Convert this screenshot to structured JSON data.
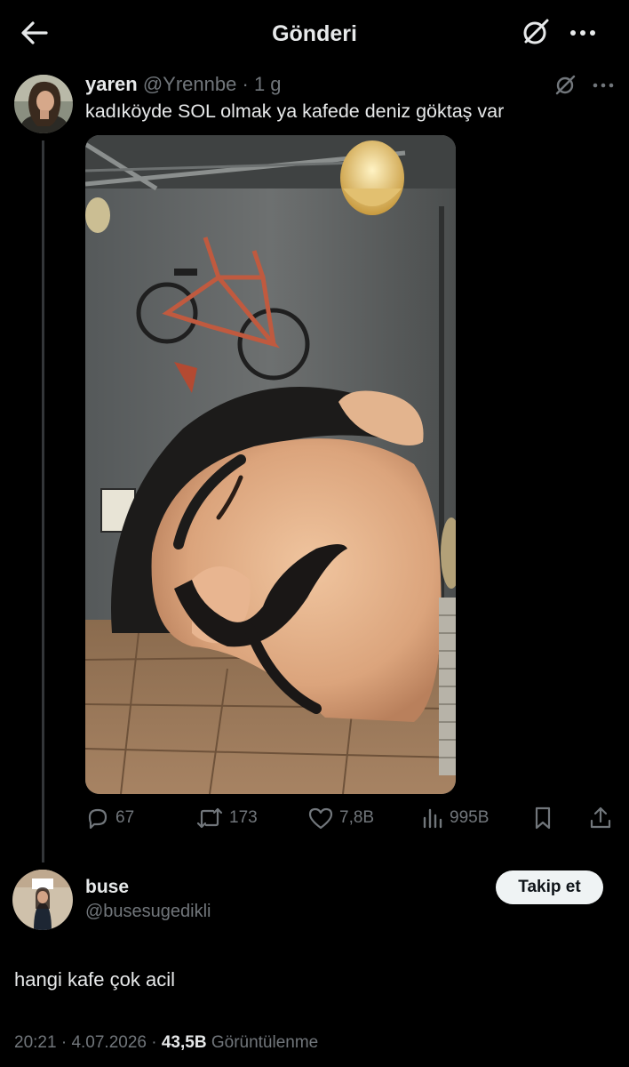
{
  "header": {
    "title": "Gönderi"
  },
  "post": {
    "author_name": "yaren",
    "author_handle": "@Yrennbe",
    "separator": "·",
    "time": "1 g",
    "text": "kadıköyde SOL olmak ya kafede deniz göktaş var",
    "stats": {
      "replies": "67",
      "reposts": "173",
      "likes": "7,8B",
      "views": "995B"
    }
  },
  "reply": {
    "author_name": "buse",
    "author_handle": "@busesugedikli",
    "follow_label": "Takip et",
    "text": "hangi kafe çok acil",
    "time": "20:21",
    "separator": "·",
    "date": "4.07.2026",
    "separator2": "·",
    "views_count": "43,5B",
    "views_label": "Görüntülenme"
  },
  "icons": {
    "back": "arrow-left-icon",
    "grok": "grok-icon",
    "more": "more-icon",
    "reply": "reply-icon",
    "repost": "repost-icon",
    "like": "heart-icon",
    "views": "views-icon",
    "bookmark": "bookmark-icon",
    "share": "share-icon"
  },
  "colors": {
    "background": "#000000",
    "text": "#e7e9ea",
    "muted": "#71767b",
    "follow_bg": "#eff3f4"
  }
}
